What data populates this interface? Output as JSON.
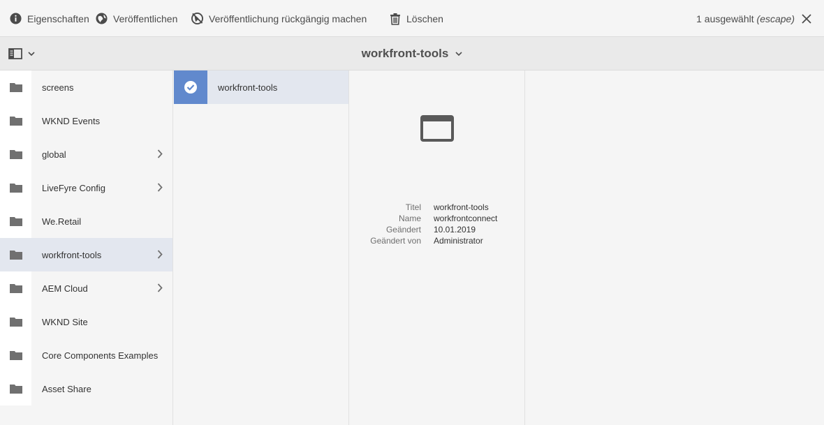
{
  "actionbar": {
    "actions": [
      {
        "label": "Eigenschaften",
        "icon": "info-icon"
      },
      {
        "label": "Veröffentlichen",
        "icon": "globe-icon"
      },
      {
        "label": "Veröffentlichung rückgängig machen",
        "icon": "globe-strike-icon"
      },
      {
        "label": "Löschen",
        "icon": "trash-icon"
      }
    ],
    "selection": {
      "count_text": "1 ausgewählt",
      "escape_text": "(escape)",
      "close_icon": "close-icon"
    }
  },
  "titlebar": {
    "title": "workfront-tools",
    "rail_icon": "rail-toggle-icon"
  },
  "column1": {
    "items": [
      {
        "label": "screens",
        "has_children": false,
        "active": false
      },
      {
        "label": "WKND Events",
        "has_children": false,
        "active": false
      },
      {
        "label": "global",
        "has_children": true,
        "active": false
      },
      {
        "label": "LiveFyre Config",
        "has_children": true,
        "active": false
      },
      {
        "label": "We.Retail",
        "has_children": false,
        "active": false
      },
      {
        "label": "workfront-tools",
        "has_children": true,
        "active": true
      },
      {
        "label": "AEM Cloud",
        "has_children": true,
        "active": false
      },
      {
        "label": "WKND Site",
        "has_children": false,
        "active": false
      },
      {
        "label": "Core Components Examples",
        "has_children": false,
        "active": false
      },
      {
        "label": "Asset Share",
        "has_children": false,
        "active": false
      }
    ]
  },
  "column2": {
    "selected_item": {
      "label": "workfront-tools",
      "selected": true
    }
  },
  "preview": {
    "icon": "browser-window-icon",
    "meta": [
      {
        "key": "Titel",
        "value": "workfront-tools"
      },
      {
        "key": "Name",
        "value": "workfrontconnect"
      },
      {
        "key": "Geändert",
        "value": "10.01.2019"
      },
      {
        "key": "Geändert von",
        "value": "Administrator"
      }
    ]
  },
  "colors": {
    "accent": "#6189cd",
    "selected_row": "#e3e7ef",
    "background": "#f5f5f5"
  }
}
